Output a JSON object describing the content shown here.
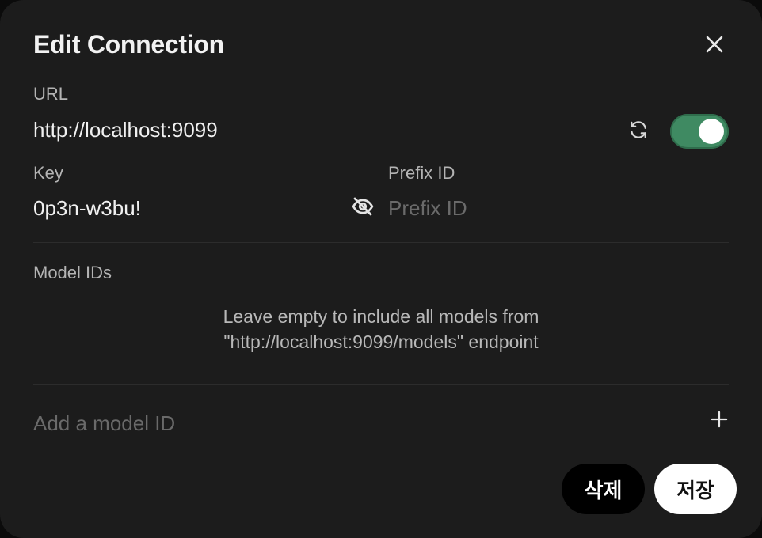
{
  "dialog": {
    "title": "Edit Connection"
  },
  "url": {
    "label": "URL",
    "value": "http://localhost:9099",
    "enabled": true
  },
  "key": {
    "label": "Key",
    "value": "0p3n-w3bu!"
  },
  "prefix": {
    "label": "Prefix ID",
    "placeholder": "Prefix ID",
    "value": ""
  },
  "models": {
    "label": "Model IDs",
    "help_line1": "Leave empty to include all models from",
    "help_line2": "\"http://localhost:9099/models\" endpoint",
    "add_placeholder": "Add a model ID"
  },
  "actions": {
    "delete_label": "삭제",
    "save_label": "저장"
  },
  "colors": {
    "background": "#1c1c1c",
    "toggle_on": "#3f8a62",
    "muted_text": "#b4b4b4"
  },
  "icons": [
    "close-icon",
    "refresh-icon",
    "eye-off-icon",
    "plus-icon"
  ]
}
